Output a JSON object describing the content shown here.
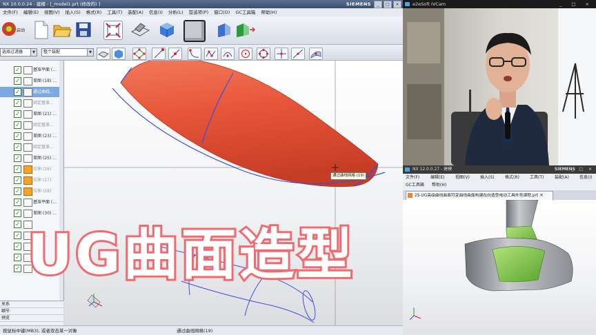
{
  "left_window": {
    "title": "NX 10.0.0.24 - 建模 - [_model1.prt  (修改的) ]",
    "brand": "SIEMENS",
    "window_buttons": [
      "_",
      "□",
      "×"
    ],
    "menu": [
      "文件(F)",
      "编辑(E)",
      "视图(V)",
      "插入(S)",
      "格式(R)",
      "工具(T)",
      "装配(A)",
      "信息(I)",
      "分析(L)",
      "首选项(P)",
      "窗口(O)",
      "GC工具箱",
      "帮助(H)"
    ],
    "start_label": "启动",
    "selection_filter": "选择过滤器",
    "selection_scope": "整个装配",
    "navigator_items": [
      {
        "label": "基准平面 (...",
        "icon": "datum-plane-icon",
        "selected": false,
        "dim": false
      },
      {
        "label": "草图 (18) ...",
        "icon": "sketch-icon",
        "selected": false,
        "dim": false
      },
      {
        "label": "通过曲线...",
        "icon": "mesh-surface-icon",
        "selected": true,
        "dim": false
      },
      {
        "label": "固定基准...",
        "icon": "datum-plane-icon",
        "selected": false,
        "dim": true
      },
      {
        "label": "草图 (21) ...",
        "icon": "sketch-icon",
        "selected": false,
        "dim": false
      },
      {
        "label": "固定基准...",
        "icon": "datum-plane-icon",
        "selected": false,
        "dim": true
      },
      {
        "label": "草图 (23) ...",
        "icon": "sketch-icon",
        "selected": false,
        "dim": false
      },
      {
        "label": "固定基准...",
        "icon": "datum-plane-icon",
        "selected": false,
        "dim": true
      },
      {
        "label": "草图 (25) ...",
        "icon": "sketch-icon",
        "selected": false,
        "dim": false
      },
      {
        "label": "拉伸 (26)",
        "icon": "extrude-icon",
        "selected": false,
        "dim": true
      },
      {
        "label": "拉伸 (27)",
        "icon": "extrude-icon",
        "selected": false,
        "dim": true
      },
      {
        "label": "拉伸 (28)",
        "icon": "extrude-icon",
        "selected": false,
        "dim": true
      },
      {
        "label": "基准平面 (...",
        "icon": "datum-plane-icon",
        "selected": false,
        "dim": false
      },
      {
        "label": "草图 (30) ...",
        "icon": "sketch-icon",
        "selected": false,
        "dim": false
      },
      {
        "label": "",
        "icon": "sketch-icon",
        "selected": false,
        "dim": false
      },
      {
        "label": "(32) ...",
        "icon": "sketch-icon",
        "selected": false,
        "dim": false
      },
      {
        "label": "",
        "icon": "sketch-icon",
        "selected": false,
        "dim": false
      },
      {
        "label": "",
        "icon": "sketch-icon",
        "selected": false,
        "dim": false
      },
      {
        "label": "",
        "icon": "sketch-icon",
        "selected": false,
        "dim": false
      }
    ],
    "navigator_bottom": [
      "关系",
      "细节",
      "预览"
    ],
    "tooltip": "通过曲线网格 (19)",
    "status_left": "按鼠标中键(MB3), 或者双击某一对象",
    "status_center": "通过曲线网格(19)"
  },
  "overlay_title": "UG曲面造型",
  "webcam": {
    "title": "e2eSoft iVCam",
    "buttons": [
      "_",
      "□",
      "×"
    ]
  },
  "right_window": {
    "title": "NX 12.0.0.27 - 建模",
    "brand": "SIEMENS",
    "menu_row1": [
      "文件(F)",
      "编辑(E)",
      "视图(V)",
      "插入(S)",
      "格式(R)",
      "工具(T)",
      "装配(A)",
      "信息(I)",
      "分析(L)",
      "首选项(P)",
      "窗口(O)"
    ],
    "menu_row2": [
      "GC工具箱",
      "帮助(H)"
    ],
    "tab_label": "25-UG高级曲线曲面可变曲线曲面构建在向造型电动工具外壳课程.prt",
    "tab_close": "×"
  },
  "colors": {
    "accent_title": "#f06b70",
    "model_orange": "#e8563a",
    "curve_blue": "#2a3fd0",
    "model_green": "#7cc44a"
  }
}
